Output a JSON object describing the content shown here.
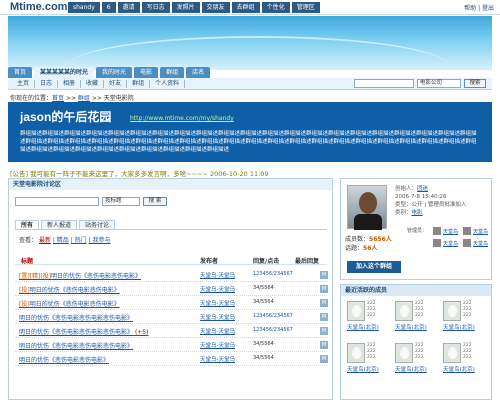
{
  "site": {
    "logo": "Mtime.com",
    "nav": [
      "shandy",
      "6",
      "邀请",
      "写日志",
      "发照片",
      "交朋友",
      "去群组",
      "个性化",
      "管理区"
    ],
    "links": "帮助 | 登出"
  },
  "tabs": [
    "首页",
    "某某某某某的时光",
    "我的时光",
    "电影",
    "群组",
    "店名"
  ],
  "subnav": [
    "主页",
    "日志",
    "相册",
    "收藏",
    "好友",
    "群组",
    "个人资料"
  ],
  "search": {
    "select": "电影公司",
    "button": "搜索"
  },
  "breadcrumb": {
    "prefix": "你现在的位置：",
    "home": "首页",
    "sep1": " >> ",
    "group": "群组",
    "sep2": " >> ",
    "current": "天堂电影院"
  },
  "hero": {
    "title": "jason的午后花园",
    "url": "http://www.mtime.com/my/shandy",
    "desc": "群组描述群组描述群组描述群组描述群组描述群组描述群组描述群组描述群组描述群组描述群组描述群组描述群组描述群组描述群组描述群组描述群组描述群组描述群组描述群组描述群组描述群组描述群组描述群组描述群组描述群组描述群组描述群组描述群组描述群组描述群组描述群组描述群组描述群组描述群组描述群组描述群组描述群组描述群组描述群组描述群组描述群组描述群组描述群组描述群组描述群组描述群组描述群组描述群组描述群组描述群组描述"
  },
  "notice": "[公告] 我可能有一阵子不能来这里了，大家多多发言啊，多啥~~~~ 2006-10-20 11:09",
  "forum": {
    "title": "天堂电影院讨论区",
    "select": "按标题",
    "button": "搜 索",
    "tabs": [
      "所有",
      "新人报道",
      "站务讨论"
    ],
    "sort": {
      "label": "查看：",
      "all": "最新",
      "items": [
        "| 精品",
        "| 热门",
        "| 我参与"
      ]
    },
    "columns": [
      "标题",
      "发布者",
      "回复/点击",
      "最后回复"
    ],
    "rows": [
      {
        "tag": "[置][精][投]",
        "title": "明日的忧伤《悲伤电影悲伤电影》",
        "author": "天堂乌-天堂乌",
        "rv": "123456/234567",
        "icon": "M"
      },
      {
        "tag": "[投]",
        "title": "明日的忧伤《悲伤电影悲伤电影》",
        "author": "天堂乌-天堂乌",
        "rv": "34/5564",
        "icon": "M"
      },
      {
        "tag": "[投]",
        "title": "明日的忧伤《悲伤电影悲伤电影》",
        "author": "天堂乌-天堂乌",
        "rv": "34/5564",
        "icon": "M"
      },
      {
        "tag": "",
        "title": "明日的忧伤《悲伤电影悲伤电影悲伤电影》",
        "author": "天堂乌-天堂乌",
        "rv": "123456/234567",
        "icon": "M"
      },
      {
        "tag": "",
        "title": "明日的忧伤《悲伤电影悲伤电影悲伤电影》",
        "count": "(+5)",
        "author": "天堂乌-天堂乌",
        "rv": "123456/234567",
        "icon": "M"
      },
      {
        "tag": "",
        "title": "明日的忧伤《悲伤电影悲伤电影悲伤电影》",
        "author": "天堂乌-天堂乌",
        "rv": "34/5564",
        "icon": "M"
      },
      {
        "tag": "",
        "title": "明日的忧伤《悲伤电影悲伤电影》",
        "author": "天堂乌-天堂乌",
        "rv": "34/5564",
        "icon": "M"
      }
    ]
  },
  "group": {
    "creator_label": "创始人：",
    "creator": "团迷",
    "created": "2006-7-8 15:40:26",
    "type_label": "类型：公开 | 管理员批准加入",
    "cat_label": "类别：",
    "cat": "电影",
    "members_label": "成员数：",
    "members": "5656人",
    "posts_label": "话题：",
    "posts": "56人",
    "admins_label": "管理员：",
    "admin": "天堂鸟",
    "join": "加入这个群组"
  },
  "recent": {
    "title": "最近活跃的成员",
    "name": "天堂鸟",
    "city": "(北京)",
    "stat": "222"
  }
}
